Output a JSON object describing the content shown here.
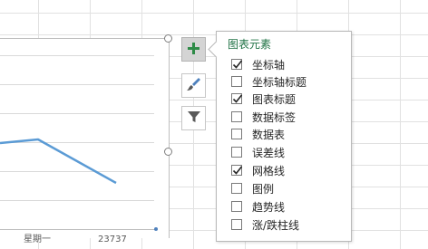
{
  "chart_elements": {
    "title": "图表元素",
    "items": [
      {
        "label": "坐标轴",
        "checked": true
      },
      {
        "label": "坐标轴标题",
        "checked": false
      },
      {
        "label": "图表标题",
        "checked": true
      },
      {
        "label": "数据标签",
        "checked": false
      },
      {
        "label": "数据表",
        "checked": false
      },
      {
        "label": "误差线",
        "checked": false
      },
      {
        "label": "网格线",
        "checked": true
      },
      {
        "label": "图例",
        "checked": false
      },
      {
        "label": "趋势线",
        "checked": false
      },
      {
        "label": "涨/跌柱线",
        "checked": false
      }
    ]
  },
  "side_buttons": [
    {
      "name": "chart-elements",
      "icon": "plus-icon",
      "active": true
    },
    {
      "name": "chart-styles",
      "icon": "brush-icon",
      "active": false
    },
    {
      "name": "chart-filters",
      "icon": "filter-icon",
      "active": false
    }
  ],
  "chart": {
    "series_color": "#5b9bd5",
    "accent": "#217346"
  }
}
